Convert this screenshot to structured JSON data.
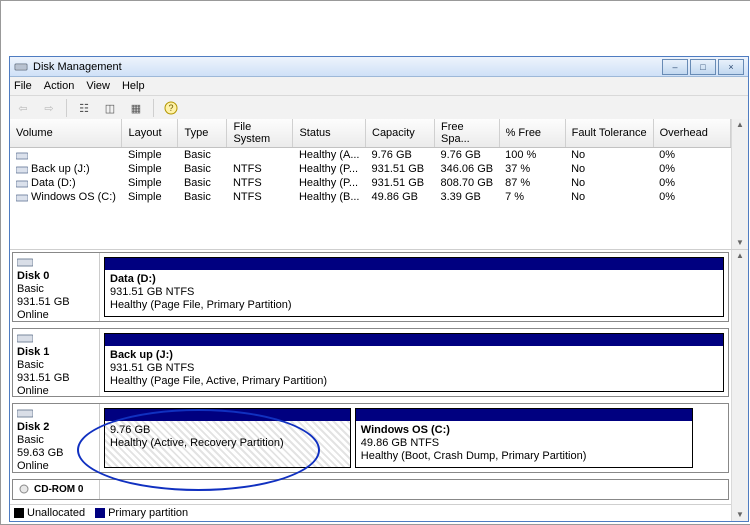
{
  "window": {
    "title": "Disk Management",
    "btn_minimize": "–",
    "btn_maximize": "□",
    "btn_close": "×"
  },
  "menu": {
    "file": "File",
    "action": "Action",
    "view": "View",
    "help": "Help"
  },
  "volume_table": {
    "headers": {
      "volume": "Volume",
      "layout": "Layout",
      "type": "Type",
      "filesystem": "File System",
      "status": "Status",
      "capacity": "Capacity",
      "freespace": "Free Spa...",
      "pctfree": "% Free",
      "fault": "Fault Tolerance",
      "overhead": "Overhead"
    },
    "rows": [
      {
        "volume": "",
        "layout": "Simple",
        "type": "Basic",
        "filesystem": "",
        "status": "Healthy (A...",
        "capacity": "9.76 GB",
        "freespace": "9.76 GB",
        "pctfree": "100 %",
        "fault": "No",
        "overhead": "0%"
      },
      {
        "volume": "Back up (J:)",
        "layout": "Simple",
        "type": "Basic",
        "filesystem": "NTFS",
        "status": "Healthy (P...",
        "capacity": "931.51 GB",
        "freespace": "346.06 GB",
        "pctfree": "37 %",
        "fault": "No",
        "overhead": "0%"
      },
      {
        "volume": "Data (D:)",
        "layout": "Simple",
        "type": "Basic",
        "filesystem": "NTFS",
        "status": "Healthy (P...",
        "capacity": "931.51 GB",
        "freespace": "808.70 GB",
        "pctfree": "87 %",
        "fault": "No",
        "overhead": "0%"
      },
      {
        "volume": "Windows OS (C:)",
        "layout": "Simple",
        "type": "Basic",
        "filesystem": "NTFS",
        "status": "Healthy (B...",
        "capacity": "49.86 GB",
        "freespace": "3.39 GB",
        "pctfree": "7 %",
        "fault": "No",
        "overhead": "0%"
      }
    ]
  },
  "disks": [
    {
      "name": "Disk 0",
      "type": "Basic",
      "size": "931.51 GB",
      "state": "Online",
      "partitions": [
        {
          "title": "Data  (D:)",
          "line2": "931.51 GB NTFS",
          "line3": "Healthy (Page File, Primary Partition)",
          "flex": 1
        }
      ]
    },
    {
      "name": "Disk 1",
      "type": "Basic",
      "size": "931.51 GB",
      "state": "Online",
      "partitions": [
        {
          "title": "Back up  (J:)",
          "line2": "931.51 GB NTFS",
          "line3": "Healthy (Page File, Active, Primary Partition)",
          "flex": 1
        }
      ]
    },
    {
      "name": "Disk 2",
      "type": "Basic",
      "size": "59.63 GB",
      "state": "Online",
      "partitions": [
        {
          "title": "",
          "line2": "9.76 GB",
          "line3": "Healthy (Active, Recovery Partition)",
          "flex": 0.4,
          "hatch": true
        },
        {
          "title": "Windows OS  (C:)",
          "line2": "49.86 GB NTFS",
          "line3": "Healthy (Boot, Crash Dump, Primary Partition)",
          "flex": 0.55
        }
      ]
    }
  ],
  "cdrom": "CD-ROM 0",
  "legend": {
    "unallocated": "Unallocated",
    "primary": "Primary partition"
  }
}
